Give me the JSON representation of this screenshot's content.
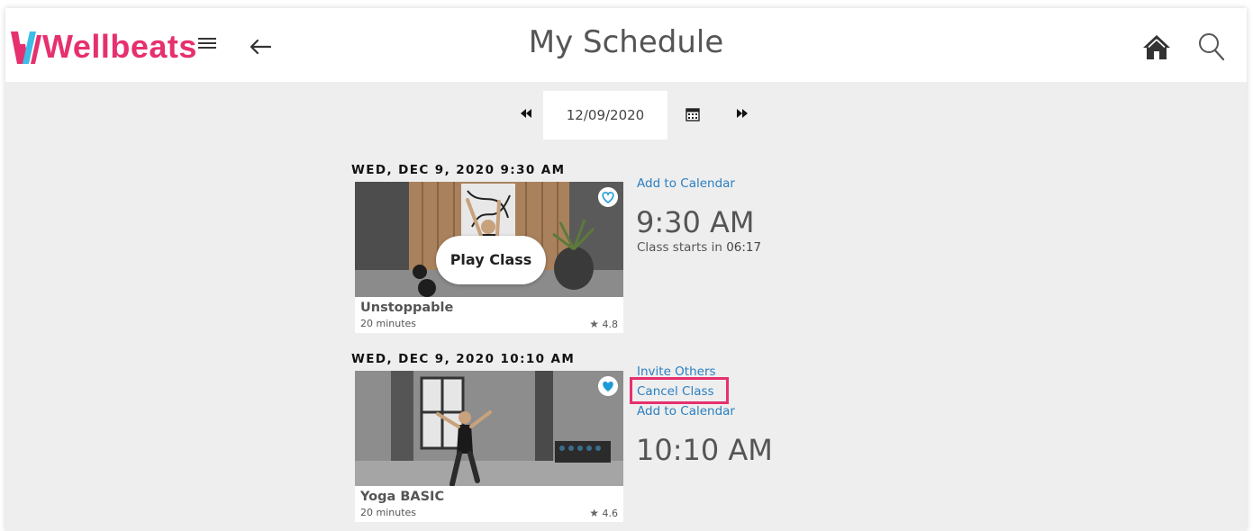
{
  "app": {
    "brand": "Wellbeats",
    "brand_color": "#e6306f"
  },
  "header": {
    "title": "My Schedule",
    "icons": [
      "menu-icon",
      "back-arrow-icon",
      "home-icon",
      "search-icon"
    ]
  },
  "date_nav": {
    "date": "12/09/2020",
    "icons": [
      "rewind-icon",
      "calendar-icon",
      "fast-forward-icon"
    ]
  },
  "classes": [
    {
      "heading": "WED, DEC 9, 2020 9:30 AM",
      "name": "Unstoppable",
      "duration": "20 minutes",
      "rating": "4.8",
      "play_label": "Play Class",
      "favorite": false,
      "actions": [
        "Add to Calendar"
      ],
      "time": "9:30 AM",
      "starts_label": "Class starts in ",
      "countdown": "06:17"
    },
    {
      "heading": "WED, DEC 9, 2020 10:10 AM",
      "name": "Yoga BASIC",
      "duration": "20 minutes",
      "rating": "4.6",
      "favorite": true,
      "actions": [
        "Invite Others",
        "Cancel Class",
        "Add to Calendar"
      ],
      "time": "10:10 AM"
    }
  ],
  "colors": {
    "link": "#2a7fc1",
    "highlight": "#e6306f",
    "heart": "#1f9ad6"
  }
}
